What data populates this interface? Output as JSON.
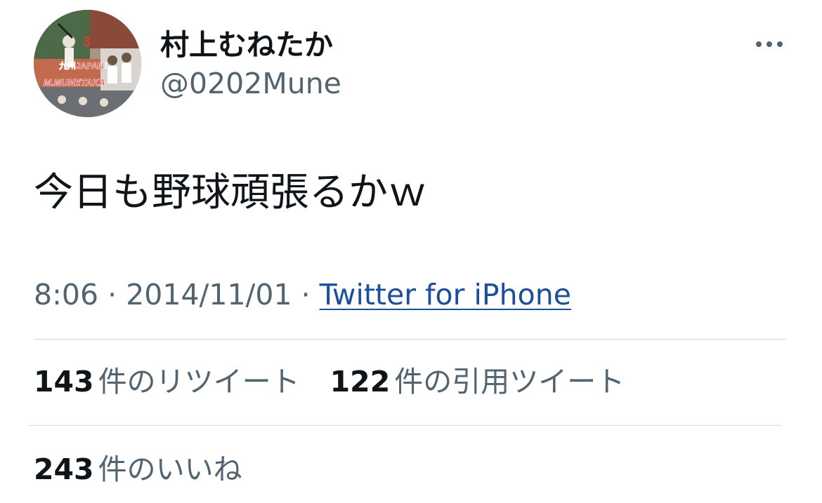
{
  "user": {
    "display_name": "村上むねたか",
    "handle": "@0202Mune"
  },
  "tweet": {
    "text": "今日も野球頑張るかｗ",
    "time": "8:06",
    "separator": "·",
    "date": "2014/11/01",
    "source": "Twitter for iPhone"
  },
  "stats": {
    "retweets": {
      "count": "143",
      "label": "件のリツイート"
    },
    "quotes": {
      "count": "122",
      "label": "件の引用ツイート"
    },
    "likes": {
      "count": "243",
      "label": "件のいいね"
    }
  },
  "avatar": {
    "number_text": "3",
    "banner_text": "九州JAPAN！",
    "name_text": "M.MUNETAKA"
  },
  "icons": {
    "more": "more-horizontal-icon"
  },
  "colors": {
    "text_primary": "#0f1419",
    "text_secondary": "#536471",
    "link": "#1b4e9b",
    "divider": "#cfd9de"
  }
}
